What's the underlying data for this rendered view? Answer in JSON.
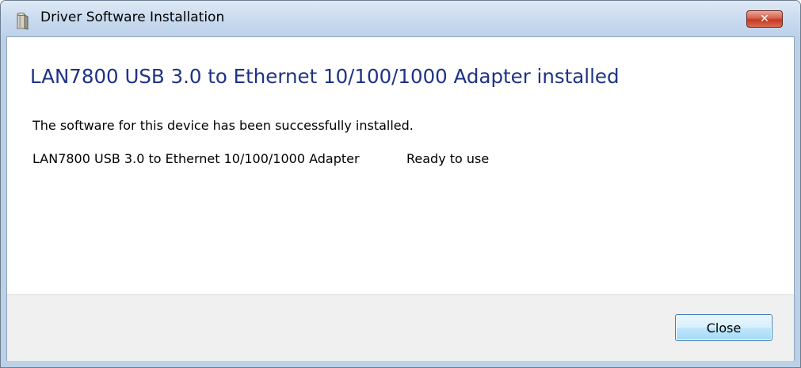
{
  "window": {
    "title": "Driver Software Installation",
    "icon": "driver-install-icon",
    "close_glyph": "✕"
  },
  "content": {
    "heading": "LAN7800 USB 3.0 to Ethernet 10/100/1000 Adapter installed",
    "message": "The software for this device has been successfully installed.",
    "device": {
      "name": "LAN7800 USB 3.0 to Ethernet 10/100/1000 Adapter",
      "status": "Ready to use"
    }
  },
  "footer": {
    "close_label": "Close"
  },
  "colors": {
    "heading": "#1e3287",
    "titlebar": "#c9dbef",
    "close_button_red": "#c23a22"
  }
}
